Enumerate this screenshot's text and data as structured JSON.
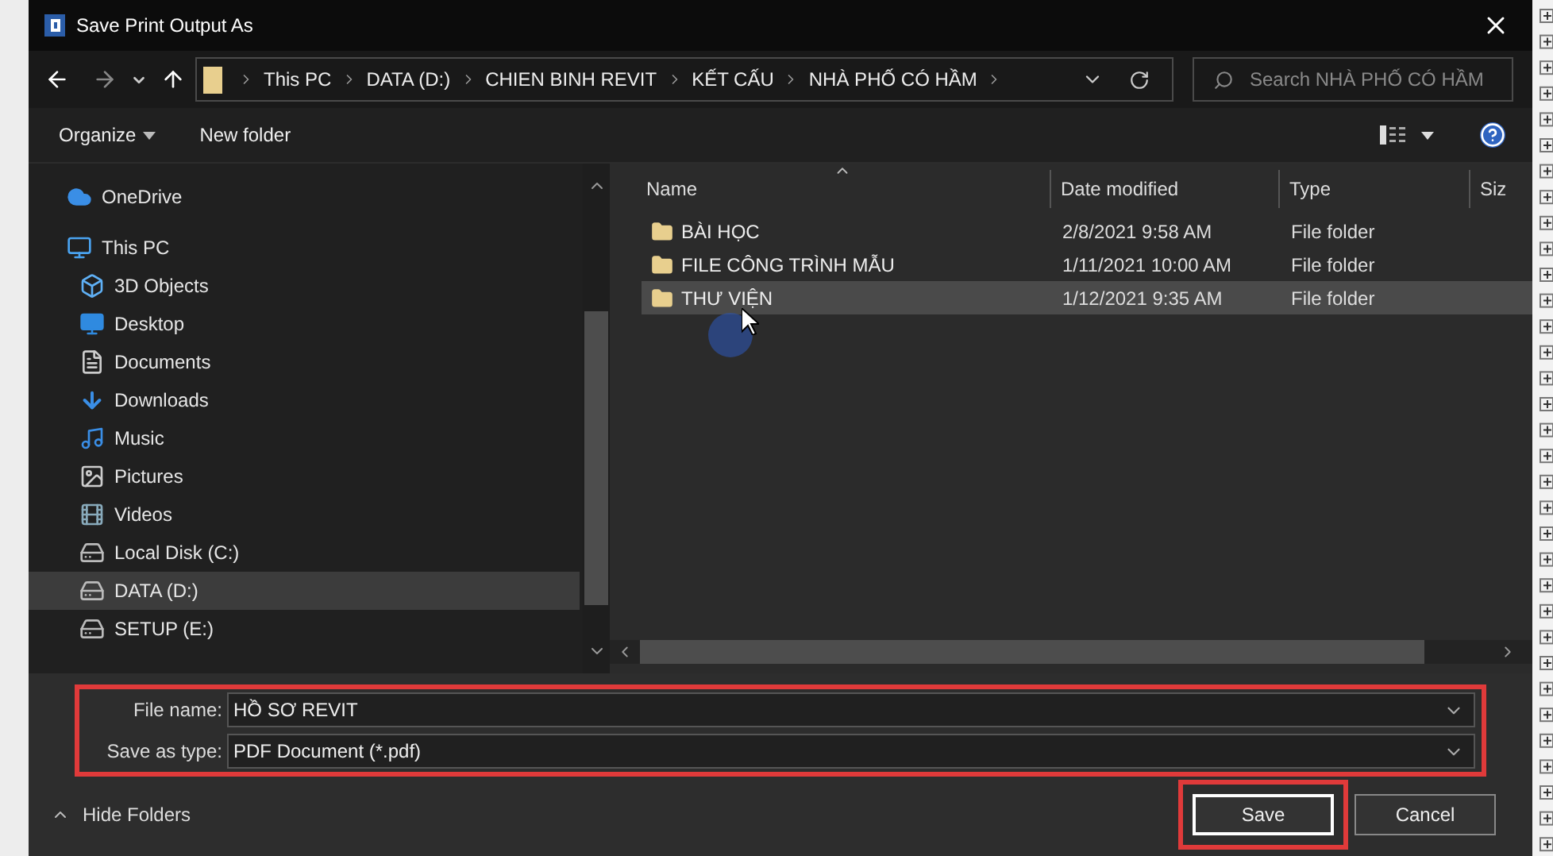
{
  "window": {
    "title": "Save Print Output As"
  },
  "address_bar": {
    "crumbs": [
      "This PC",
      "DATA (D:)",
      "CHIEN BINH REVIT",
      "KẾT CẤU",
      "NHÀ PHỐ CÓ HẦM"
    ]
  },
  "search": {
    "placeholder": "Search NHÀ PHỐ CÓ HẦM"
  },
  "toolbar": {
    "buttons": [
      "Organize",
      "New folder"
    ]
  },
  "sidebar": {
    "items": [
      {
        "label": "OneDrive",
        "kind": "cloud",
        "selected": false
      },
      {
        "label": "This PC",
        "kind": "pc",
        "selected": false,
        "children": [
          {
            "label": "3D Objects",
            "kind": "cube",
            "selected": false
          },
          {
            "label": "Desktop",
            "kind": "desktop",
            "selected": false
          },
          {
            "label": "Documents",
            "kind": "documents",
            "selected": false
          },
          {
            "label": "Downloads",
            "kind": "download",
            "selected": false
          },
          {
            "label": "Music",
            "kind": "music",
            "selected": false
          },
          {
            "label": "Pictures",
            "kind": "pictures",
            "selected": false
          },
          {
            "label": "Videos",
            "kind": "videos",
            "selected": false
          },
          {
            "label": "Local Disk (C:)",
            "kind": "system",
            "selected": false
          },
          {
            "label": "DATA (D:)",
            "kind": "drive",
            "selected": true
          },
          {
            "label": "SETUP (E:)",
            "kind": "drive",
            "selected": false
          }
        ]
      }
    ]
  },
  "file_list": {
    "columns": [
      "Name",
      "Date modified",
      "Type",
      "Siz"
    ],
    "rows": [
      {
        "name": "BÀI HỌC",
        "date": "2/8/2021 9:58 AM",
        "type": "File folder",
        "selected": false
      },
      {
        "name": "FILE CÔNG TRÌNH MẪU",
        "date": "1/11/2021 10:00 AM",
        "type": "File folder",
        "selected": false
      },
      {
        "name": "THƯ VIỆN",
        "date": "1/12/2021 9:35 AM",
        "type": "File folder",
        "selected": true
      }
    ]
  },
  "form": {
    "fields": [
      {
        "label": "File name:",
        "value": "HỒ SƠ REVIT"
      },
      {
        "label": "Save as type:",
        "value": "PDF Document (*.pdf)"
      }
    ]
  },
  "hide_folders": "Hide Folders",
  "buttons": [
    {
      "label": "Save",
      "default": true
    },
    {
      "label": "Cancel",
      "default": false
    }
  ]
}
